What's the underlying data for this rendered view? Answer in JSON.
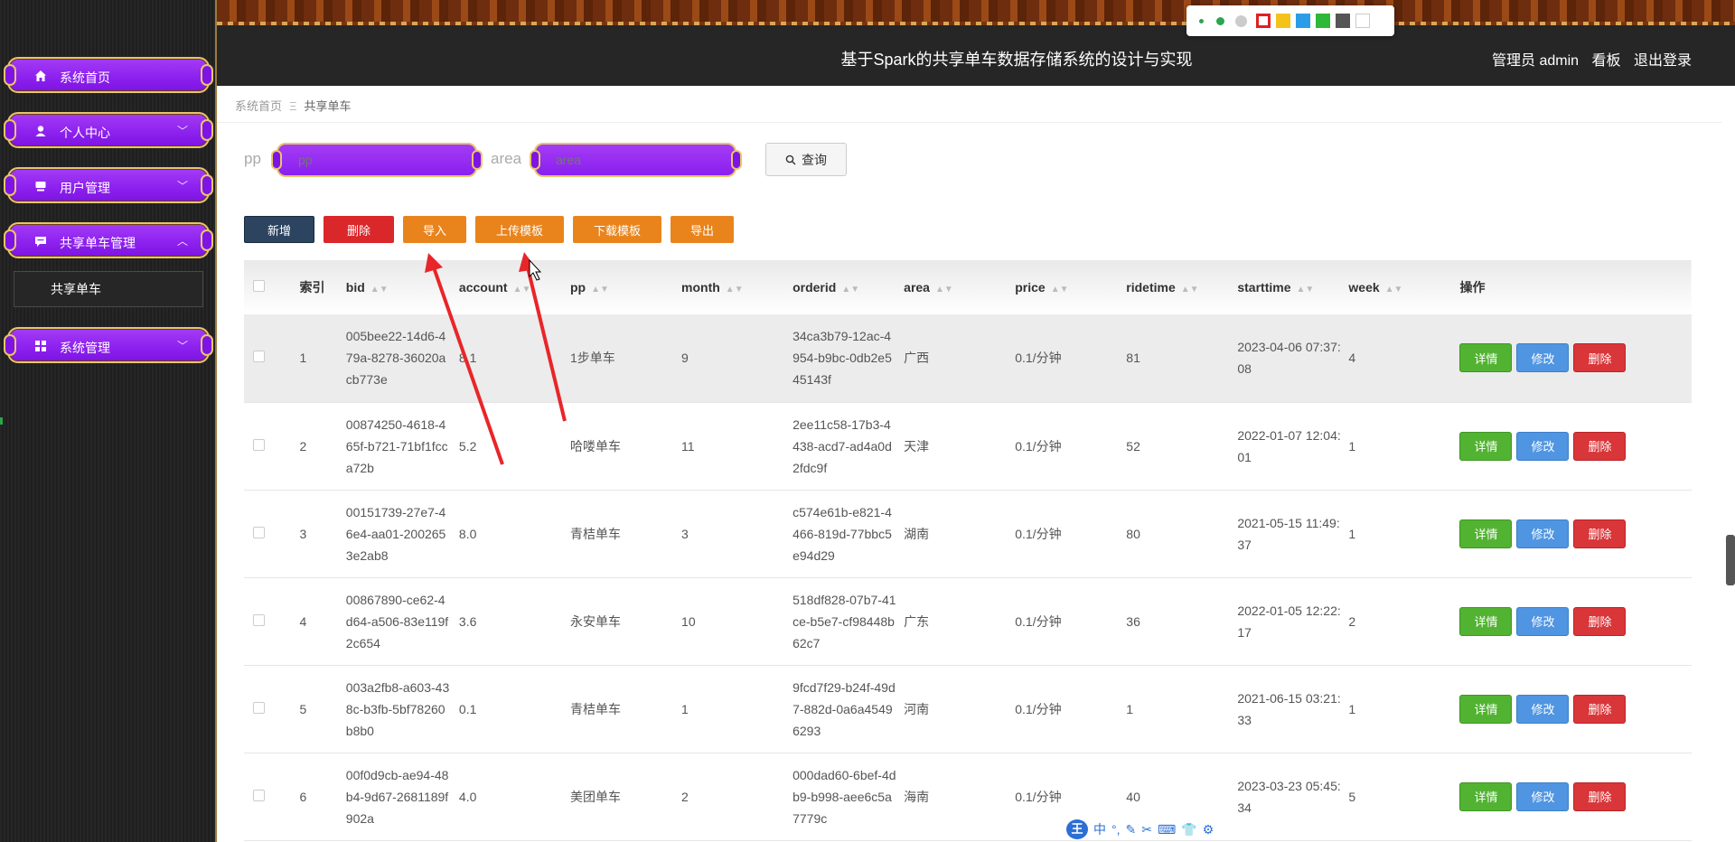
{
  "header": {
    "title": "基于Spark的共享单车数据存储系统的设计与实现",
    "user_label": "管理员 admin",
    "dashboard_label": "看板",
    "logout_label": "退出登录"
  },
  "colors": {
    "primary": "#8e22ef",
    "gold": "#e7c56b",
    "sidebar_bg": "#262626"
  },
  "sidebar": {
    "items": [
      {
        "label": "系统首页",
        "icon": "home-icon"
      },
      {
        "label": "个人中心",
        "icon": "user-icon"
      },
      {
        "label": "用户管理",
        "icon": "users-icon"
      },
      {
        "label": "共享单车管理",
        "icon": "chat-icon"
      },
      {
        "label": "系统管理",
        "icon": "grid-icon"
      }
    ],
    "sub_item": "共享单车"
  },
  "breadcrumb": {
    "home": "系统首页",
    "current": "共享单车"
  },
  "search": {
    "pp_label": "pp",
    "pp_placeholder": "pp",
    "area_label": "area",
    "area_placeholder": "area",
    "query_label": "查询"
  },
  "toolbar": {
    "add": "新增",
    "delete": "删除",
    "import": "导入",
    "upload_template": "上传模板",
    "download_template": "下载模板",
    "export": "导出"
  },
  "table": {
    "headers": [
      "索引",
      "bid",
      "account",
      "pp",
      "month",
      "orderid",
      "area",
      "price",
      "ridetime",
      "starttime",
      "week",
      "操作"
    ],
    "actions": {
      "detail": "详情",
      "edit": "修改",
      "delete": "删除"
    },
    "rows": [
      {
        "idx": "1",
        "bid": "005bee22-14d6-479a-8278-36020acb773e",
        "account": "8.1",
        "pp": "1步单车",
        "month": "9",
        "orderid": "34ca3b79-12ac-4954-b9bc-0db2e545143f",
        "area": "广西",
        "price": "0.1/分钟",
        "ridetime": "81",
        "starttime": "2023-04-06 07:37:08",
        "week": "4"
      },
      {
        "idx": "2",
        "bid": "00874250-4618-465f-b721-71bf1fcca72b",
        "account": "5.2",
        "pp": "哈喽单车",
        "month": "11",
        "orderid": "2ee11c58-17b3-4438-acd7-ad4a0d2fdc9f",
        "area": "天津",
        "price": "0.1/分钟",
        "ridetime": "52",
        "starttime": "2022-01-07 12:04:01",
        "week": "1"
      },
      {
        "idx": "3",
        "bid": "00151739-27e7-46e4-aa01-2002653e2ab8",
        "account": "8.0",
        "pp": "青桔单车",
        "month": "3",
        "orderid": "c574e61b-e821-4466-819d-77bbc5e94d29",
        "area": "湖南",
        "price": "0.1/分钟",
        "ridetime": "80",
        "starttime": "2021-05-15 11:49:37",
        "week": "1"
      },
      {
        "idx": "4",
        "bid": "00867890-ce62-4d64-a506-83e119f2c654",
        "account": "3.6",
        "pp": "永安单车",
        "month": "10",
        "orderid": "518df828-07b7-41ce-b5e7-cf98448b62c7",
        "area": "广东",
        "price": "0.1/分钟",
        "ridetime": "36",
        "starttime": "2022-01-05 12:22:17",
        "week": "2"
      },
      {
        "idx": "5",
        "bid": "003a2fb8-a603-438c-b3fb-5bf78260b8b0",
        "account": "0.1",
        "pp": "青桔单车",
        "month": "1",
        "orderid": "9fcd7f29-b24f-49d7-882d-0a6a45496293",
        "area": "河南",
        "price": "0.1/分钟",
        "ridetime": "1",
        "starttime": "2021-06-15 03:21:33",
        "week": "1"
      },
      {
        "idx": "6",
        "bid": "00f0d9cb-ae94-48b4-9d67-2681189f902a",
        "account": "4.0",
        "pp": "美团单车",
        "month": "2",
        "orderid": "000dad60-6bef-4db9-b998-aee6c5a7779c",
        "area": "海南",
        "price": "0.1/分钟",
        "ridetime": "40",
        "starttime": "2023-03-23 05:45:34",
        "week": "5"
      }
    ]
  },
  "ime": {
    "logo": "王",
    "lang": "中"
  }
}
